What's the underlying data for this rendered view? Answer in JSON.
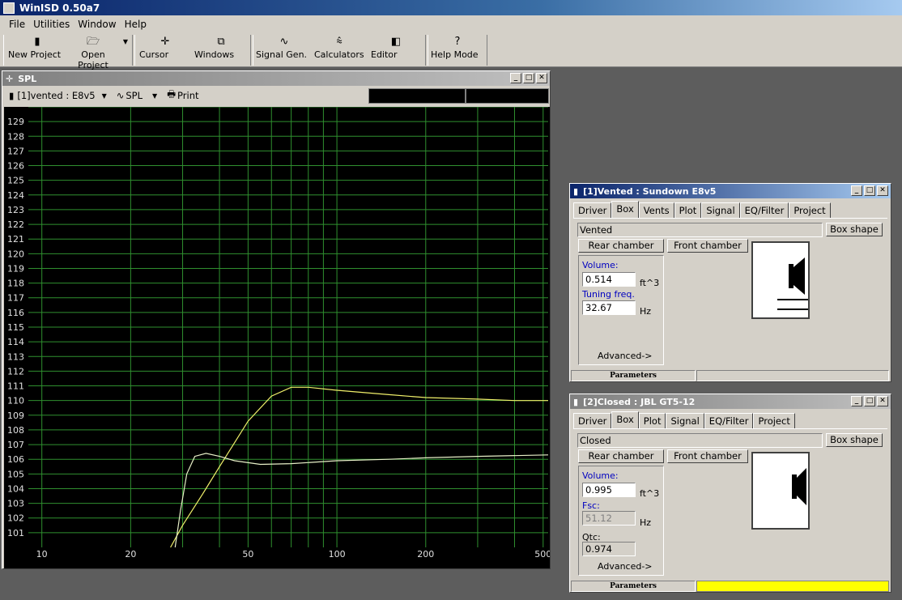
{
  "app": {
    "title": "WinISD 0.50a7"
  },
  "menu": [
    "File",
    "Utilities",
    "Window",
    "Help"
  ],
  "toolbar": [
    {
      "label": "New Project",
      "icon": "document-icon"
    },
    {
      "label": "Open Project",
      "icon": "folder-open-icon"
    },
    {
      "label": "Cursor",
      "icon": "crosshair-icon"
    },
    {
      "label": "Windows",
      "icon": "windows-icon"
    },
    {
      "label": "Signal Gen.",
      "icon": "sine-wave-icon"
    },
    {
      "label": "Calculators",
      "icon": "calculator-icon"
    },
    {
      "label": "Editor",
      "icon": "speaker-icon"
    },
    {
      "label": "Help Mode",
      "icon": "question-icon"
    }
  ],
  "spl_window": {
    "title": "SPL",
    "project_select": "[1]vented : E8v5",
    "graph_select": "SPL",
    "print_label": "Print"
  },
  "chart_data": {
    "type": "line",
    "xscale": "log",
    "xlim": [
      9,
      520
    ],
    "ylim": [
      100,
      130
    ],
    "x_ticks": [
      "10",
      "20",
      "50",
      "100",
      "200",
      "500"
    ],
    "y_ticks": [
      "101",
      "102",
      "103",
      "104",
      "105",
      "106",
      "107",
      "108",
      "109",
      "110",
      "111",
      "112",
      "113",
      "114",
      "115",
      "116",
      "117",
      "118",
      "119",
      "120",
      "121",
      "122",
      "123",
      "124",
      "125",
      "126",
      "127",
      "128",
      "129"
    ],
    "grid": true,
    "series": [
      {
        "color": "#f0f06a",
        "x": [
          27.3,
          30,
          35,
          40,
          50,
          60,
          70,
          80,
          100,
          150,
          200,
          300,
          400,
          520
        ],
        "y": [
          100,
          101.5,
          103.6,
          105.5,
          108.6,
          110.3,
          110.9,
          110.9,
          110.7,
          110.4,
          110.2,
          110.1,
          110.0,
          110.0
        ]
      },
      {
        "color": "#e8f0c8",
        "x": [
          28.3,
          29.5,
          31,
          33,
          36,
          40,
          45,
          55,
          70,
          100,
          150,
          200,
          300,
          520
        ],
        "y": [
          100,
          102.5,
          105.0,
          106.2,
          106.4,
          106.2,
          105.9,
          105.65,
          105.7,
          105.9,
          106.0,
          106.1,
          106.2,
          106.3
        ]
      }
    ]
  },
  "vented": {
    "title": "[1]Vented : Sundown  E8v5",
    "tabs": [
      "Driver",
      "Box",
      "Vents",
      "Plot",
      "Signal",
      "EQ/Filter",
      "Project"
    ],
    "selected_tab": "Box",
    "box_type": "Vented",
    "box_shape_button": "Box shape",
    "rear_button": "Rear chamber",
    "front_button": "Front chamber",
    "volume_label": "Volume:",
    "volume_value": "0.514",
    "volume_unit": "ft^3",
    "tuning_label": "Tuning freq.",
    "tuning_value": "32.67",
    "tuning_unit": "Hz",
    "advanced": "Advanced->",
    "status": "Parameters"
  },
  "closed": {
    "title": "[2]Closed : JBL GT5-12",
    "tabs": [
      "Driver",
      "Box",
      "Plot",
      "Signal",
      "EQ/Filter",
      "Project"
    ],
    "selected_tab": "Box",
    "box_type": "Closed",
    "box_shape_button": "Box shape",
    "rear_button": "Rear chamber",
    "front_button": "Front chamber",
    "volume_label": "Volume:",
    "volume_value": "0.995",
    "volume_unit": "ft^3",
    "fsc_label": "Fsc:",
    "fsc_value": "51.12",
    "fsc_unit": "Hz",
    "qtc_label": "Qtc:",
    "qtc_value": "0.974",
    "advanced": "Advanced->",
    "status": "Parameters",
    "status_accent": "#ffff00"
  }
}
